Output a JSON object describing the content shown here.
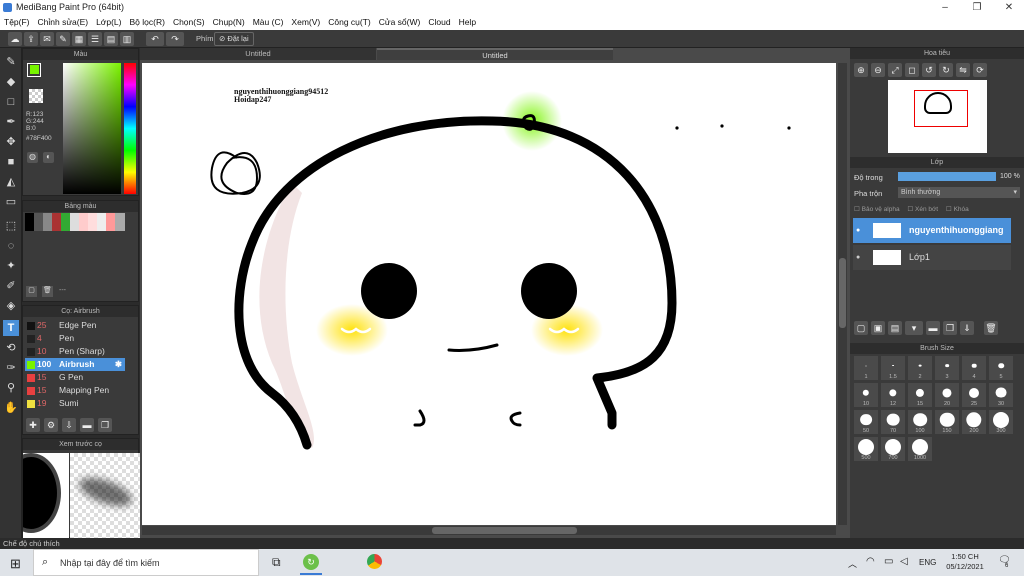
{
  "window": {
    "title": "MediBang Paint Pro (64bit)"
  },
  "menu": [
    "Tệp(F)",
    "Chỉnh sửa(E)",
    "Lớp(L)",
    "Bộ lọc(R)",
    "Chọn(S)",
    "Chụp(N)",
    "Màu (C)",
    "Xem(V)",
    "Công cụ(T)",
    "Cửa sổ(W)",
    "Cloud",
    "Help"
  ],
  "toolbar": {
    "phim_label": "Phím",
    "reset_label": "Đặt lại"
  },
  "tabs": [
    "Untitled",
    "Untitled"
  ],
  "color_panel": {
    "title": "Màu",
    "r": "R:123",
    "g": "G:244",
    "b": "B:0",
    "hex": "#78F400",
    "fg_color": "#7bf400"
  },
  "swatch_panel": {
    "title": "Bảng màu",
    "name_placeholder": "---"
  },
  "brush_panel": {
    "title": "Cọ: Airbrush",
    "items": [
      {
        "size": "25",
        "name": "Edge Pen",
        "color": "#111"
      },
      {
        "size": "4",
        "name": "Pen",
        "color": "#222"
      },
      {
        "size": "10",
        "name": "Pen (Sharp)",
        "color": "#222"
      },
      {
        "size": "100",
        "name": "Airbrush",
        "color": "#78f400"
      },
      {
        "size": "15",
        "name": "G Pen",
        "color": "#e84040"
      },
      {
        "size": "15",
        "name": "Mapping Pen",
        "color": "#e84040"
      },
      {
        "size": "19",
        "name": "Sumi",
        "color": "#f0e040"
      }
    ]
  },
  "preview_panel": {
    "title": "Xem trước cọ"
  },
  "canvas_text": {
    "line1": "nguyenthihuonggiang94512",
    "line2": "Hoidap247"
  },
  "navigator": {
    "title": "Hoa tiêu"
  },
  "layers": {
    "title": "Lớp",
    "opacity_label": "Độ trong",
    "opacity_value": "100 %",
    "blend_label": "Pha trộn",
    "blend_value": "Bình thường",
    "protect_alpha": "Bảo vệ alpha",
    "clipping": "Xén bớt",
    "lock": "Khóa",
    "items": [
      {
        "name": "nguyenthihuonggiang",
        "selected": true
      },
      {
        "name": "Lớp1",
        "selected": false
      }
    ]
  },
  "brush_size": {
    "title": "Brush Size",
    "sizes": [
      "1",
      "1.5",
      "2",
      "3",
      "4",
      "5",
      "10",
      "12",
      "15",
      "20",
      "25",
      "30",
      "50",
      "70",
      "100",
      "150",
      "200",
      "300",
      "500",
      "700",
      "1000"
    ]
  },
  "status": "Chế độ chú thích",
  "taskbar": {
    "search_placeholder": "Nhập tại đây để tìm kiếm",
    "time": "1:50 CH",
    "date": "05/12/2021",
    "lang": "ENG",
    "notif": "6"
  }
}
